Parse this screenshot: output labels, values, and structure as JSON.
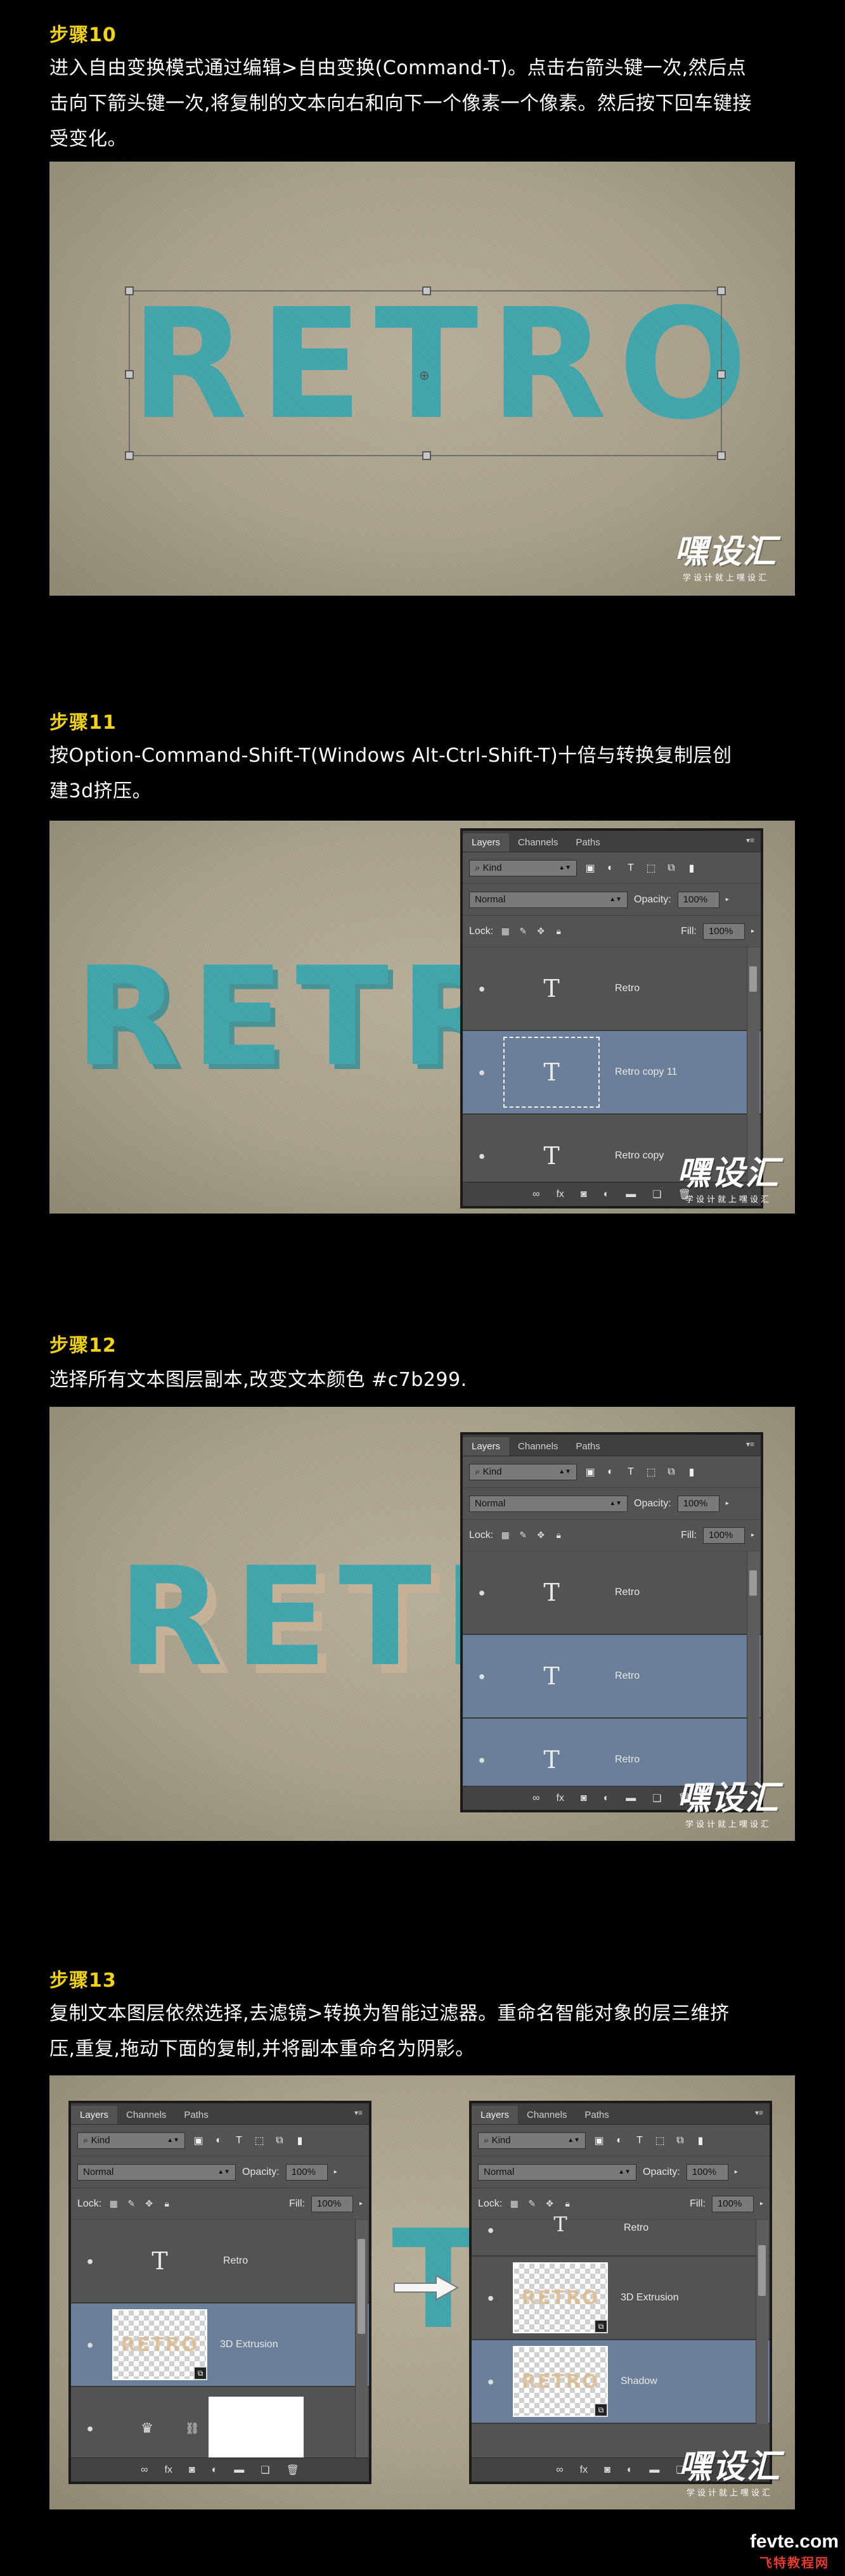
{
  "steps": [
    {
      "title": "步骤10",
      "lines": [
        "进入自由变换模式通过编辑>自由变换(Command-T)。点击右箭头键一次,然后点",
        "击向下箭头键一次,将复制的文本向右和向下一个像素一个像素。然后按下回车键接",
        "受变化。"
      ]
    },
    {
      "title": "步骤11",
      "lines": [
        "按Option-Command-Shift-T(Windows Alt-Ctrl-Shift-T)十倍与转换复制层创",
        "建3d挤压。"
      ]
    },
    {
      "title": "步骤12",
      "lines": [
        "选择所有文本图层副本,改变文本颜色 #c7b299."
      ]
    },
    {
      "title": "步骤13",
      "lines": [
        "复制文本图层依然选择,去滤镜>转换为智能过滤器。重命名智能对象的层三维挤",
        "压,重复,拖动下面的复制,并将副本重命名为阴影。"
      ]
    }
  ],
  "artwork": {
    "word": "RETRO",
    "teal": "#3fa6ac",
    "shadow": "#c7b299"
  },
  "watermark": {
    "logo": "嘿设汇",
    "sub": "学设计就上嘿设汇"
  },
  "panel": {
    "tabs": [
      "Layers",
      "Channels",
      "Paths"
    ],
    "kind": "Kind",
    "blend": "Normal",
    "opacity_label": "Opacity:",
    "opacity": "100%",
    "lock_label": "Lock:",
    "fill_label": "Fill:",
    "fill": "100%",
    "type_glyph": "T"
  },
  "layers11": [
    "Retro",
    "Retro copy 11",
    "Retro copy"
  ],
  "layers12": [
    "Retro",
    "Retro",
    "Retro"
  ],
  "layers13a": [
    "Retro",
    "3D Extrusion"
  ],
  "layers13b": [
    "Retro",
    "3D Extrusion",
    "Shadow"
  ],
  "site": {
    "name": "fevte.com",
    "sub": "飞特教程网"
  }
}
